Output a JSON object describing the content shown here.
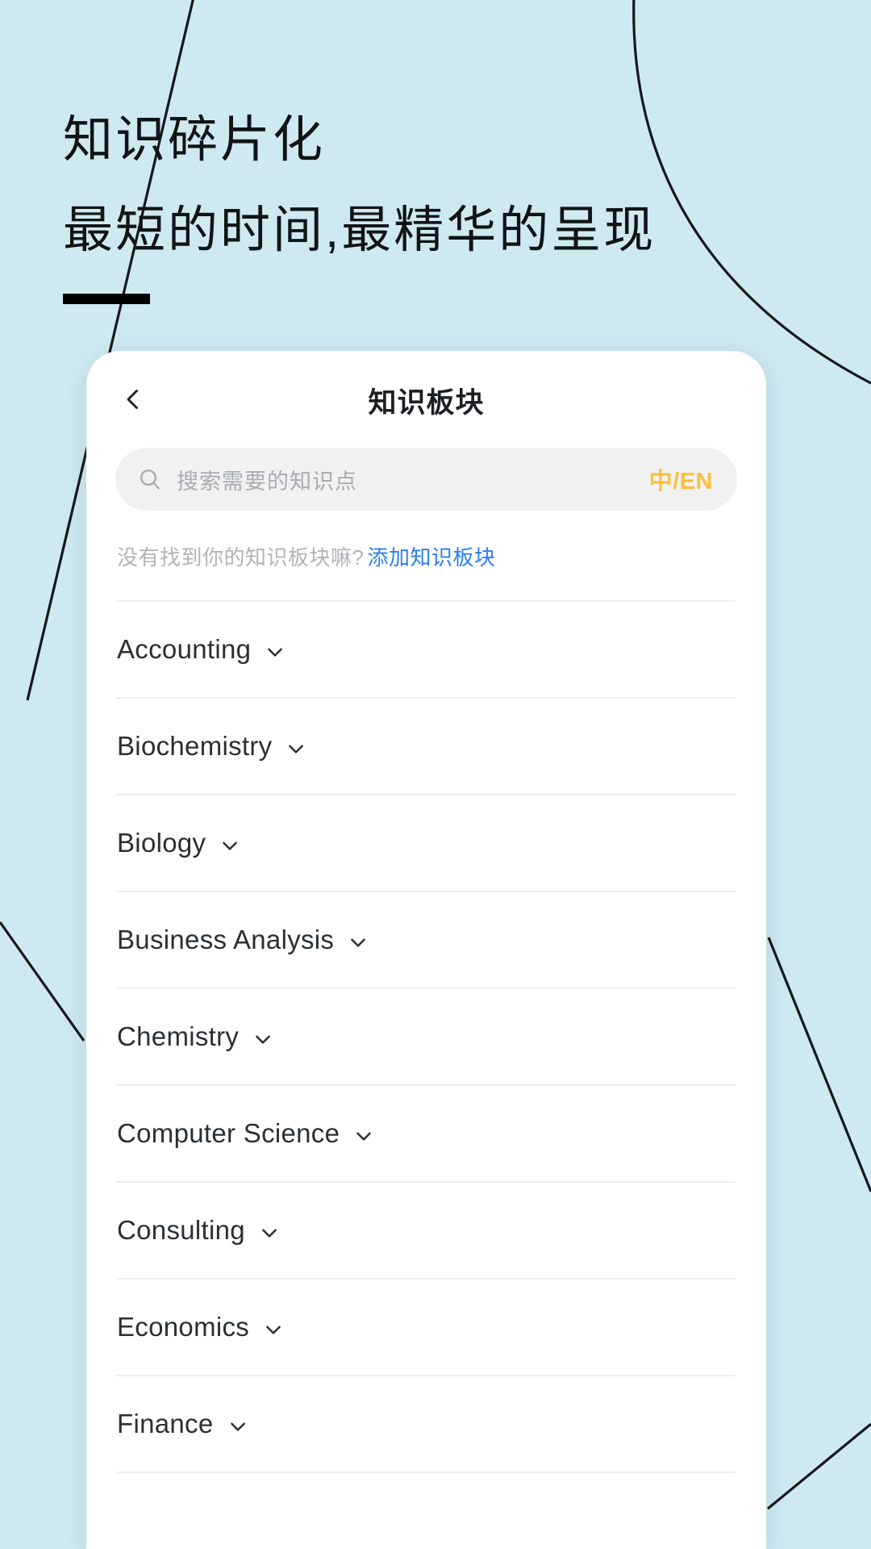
{
  "theme": {
    "background": "#cfe9f1",
    "card_background": "#ffffff",
    "accent_yellow": "#fcbf3e",
    "link_blue": "#2a7ef5",
    "text_primary": "#1c1f23",
    "text_muted": "#b1b4b8",
    "divider": "#ededee",
    "search_field": "#f1f1f2"
  },
  "hero": {
    "line1": "知识碎片化",
    "line2": "最短的时间,最精华的呈现"
  },
  "card": {
    "navbar": {
      "back_icon": "chevron-left-icon",
      "title": "知识板块"
    },
    "search": {
      "icon": "search-icon",
      "placeholder": "搜索需要的知识点",
      "value": "",
      "lang_toggle": "中/EN"
    },
    "hint": {
      "text": "没有找到你的知识板块嘛?",
      "link": "添加知识板块"
    },
    "list": {
      "chevron_icon": "chevron-down-icon",
      "items": [
        {
          "label": "Accounting"
        },
        {
          "label": "Biochemistry"
        },
        {
          "label": "Biology"
        },
        {
          "label": "Business Analysis"
        },
        {
          "label": "Chemistry"
        },
        {
          "label": "Computer Science"
        },
        {
          "label": "Consulting"
        },
        {
          "label": "Economics"
        },
        {
          "label": "Finance"
        }
      ]
    }
  }
}
